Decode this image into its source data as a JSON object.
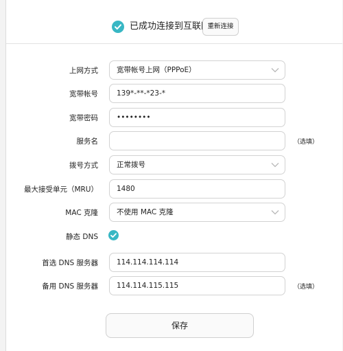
{
  "status": {
    "connected_text": "已成功连接到互联网",
    "reconnect_label": "重新连接",
    "check_icon": "check-circle-icon",
    "accent_color": "#38b7c4"
  },
  "form": {
    "connection_type": {
      "label": "上网方式",
      "value": "宽带帐号上网（PPPoE）"
    },
    "account": {
      "label": "宽带帐号",
      "value": "139*-**-*23-*"
    },
    "password": {
      "label": "宽带密码",
      "value": "••••••••"
    },
    "service_name": {
      "label": "服务名",
      "value": "",
      "optional": "（选填）"
    },
    "dial_mode": {
      "label": "拨号方式",
      "value": "正常拨号"
    },
    "mru": {
      "label": "最大接受单元（MRU）",
      "value": "1480"
    },
    "mac_clone": {
      "label": "MAC 克隆",
      "value": "不使用 MAC 克隆"
    },
    "static_dns": {
      "label": "静态 DNS",
      "checked": true
    },
    "primary_dns": {
      "label": "首选 DNS 服务器",
      "value": "114.114.114.114"
    },
    "secondary_dns": {
      "label": "备用 DNS 服务器",
      "value": "114.114.115.115",
      "optional": "（选填）"
    }
  },
  "actions": {
    "save_label": "保存"
  }
}
